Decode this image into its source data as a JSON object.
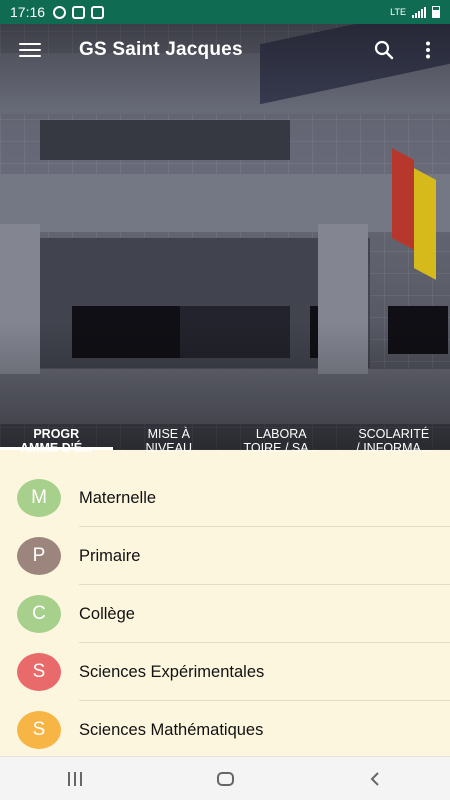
{
  "status_bar": {
    "time": "17:16",
    "network": "LTE"
  },
  "toolbar": {
    "title": "GS Saint Jacques"
  },
  "tabs": [
    {
      "label": "PROGR\nAMME D'É...",
      "active": true
    },
    {
      "label": "MISE À\nNIVEAU",
      "active": false
    },
    {
      "label": "LABORA\nTOIRE / SA...",
      "active": false
    },
    {
      "label": "SCOLARITÉ\n/ INFORMA...",
      "active": false
    }
  ],
  "list": {
    "items": [
      {
        "initial": "M",
        "label": "Maternelle",
        "color": "#a7d08c"
      },
      {
        "initial": "P",
        "label": "Primaire",
        "color": "#9c857d"
      },
      {
        "initial": "C",
        "label": "Collège",
        "color": "#a7d08c"
      },
      {
        "initial": "S",
        "label": "Sciences Expérimentales",
        "color": "#e96a6a"
      },
      {
        "initial": "S",
        "label": "Sciences Mathématiques",
        "color": "#f7b546"
      }
    ]
  },
  "colors": {
    "status_bar": "#0f6b52",
    "list_background": "#fdf6df",
    "nav_background": "#f4f4f4"
  }
}
